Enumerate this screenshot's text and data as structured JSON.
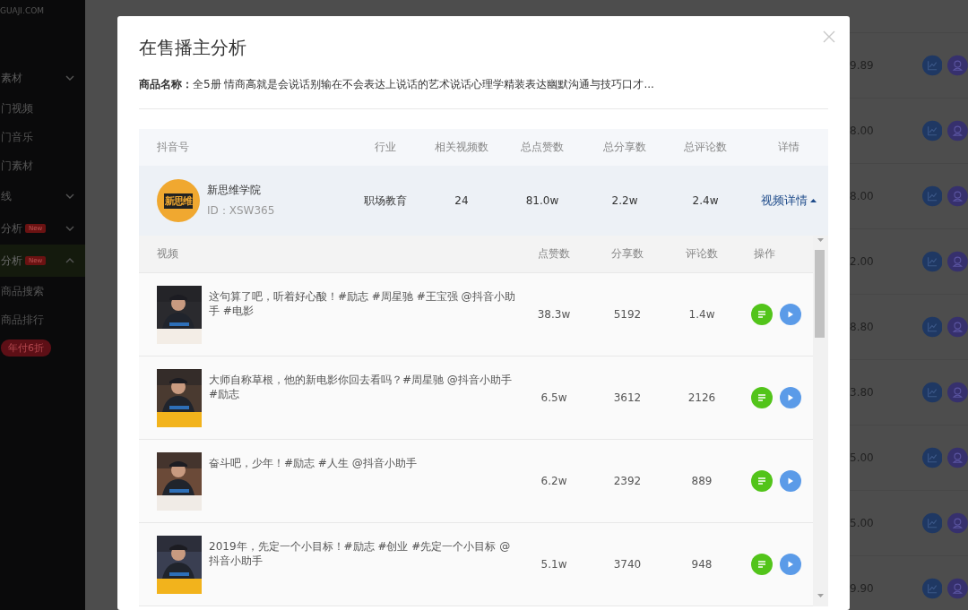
{
  "sidebar": {
    "brand": "GUAJI.COM",
    "items": [
      {
        "label": "素材",
        "kind": "group",
        "expanded": false,
        "selected": false
      },
      {
        "label": "门视频",
        "kind": "link",
        "selected": false
      },
      {
        "label": "门音乐",
        "kind": "link",
        "selected": false
      },
      {
        "label": "门素材",
        "kind": "link",
        "selected": false
      },
      {
        "label": "线",
        "kind": "group",
        "expanded": false,
        "selected": false
      },
      {
        "label": "分析",
        "kind": "group",
        "badge": "New",
        "expanded": false,
        "selected": false
      },
      {
        "label": "分析",
        "kind": "group",
        "badge": "New",
        "expanded": true,
        "selected": true
      },
      {
        "label": "商品搜索",
        "kind": "link",
        "selected": false
      },
      {
        "label": "商品排行",
        "kind": "link",
        "selected": false
      }
    ],
    "promo_badge": "年付6折"
  },
  "background_rows": [
    {
      "price": "9.89"
    },
    {
      "price": "8.00"
    },
    {
      "price": "8.00"
    },
    {
      "price": "2.00"
    },
    {
      "price": "8.80"
    },
    {
      "price": "3.80"
    },
    {
      "price": "5.00"
    },
    {
      "price": "5.00"
    },
    {
      "price": "9.90"
    }
  ],
  "modal": {
    "title": "在售播主分析",
    "product_label": "商品名称：",
    "product_name": "全5册 情商高就是会说话别输在不会表达上说话的艺术说话心理学精装表达幽默沟通与技巧口才...",
    "account_table": {
      "columns": [
        "抖音号",
        "行业",
        "相关视频数",
        "总点赞数",
        "总分享数",
        "总评论数",
        "详情"
      ],
      "rows": [
        {
          "logo_text": "新思维",
          "name": "新思维学院",
          "id": "ID：XSW365",
          "industry": "职场教育",
          "videos": "24",
          "likes": "81.0w",
          "shares": "2.2w",
          "comments": "2.4w",
          "detail": "视频详情",
          "expanded": true
        }
      ]
    },
    "video_table": {
      "columns": [
        "视频",
        "点赞数",
        "分享数",
        "评论数",
        "操作"
      ],
      "rows": [
        {
          "title": "这句算了吧，听着好心酸！#励志 #周星驰 #王宝强 @抖音小助手 #电影",
          "likes": "38.3w",
          "shares": "5192",
          "comments": "1.4w"
        },
        {
          "title": "大师自称草根，他的新电影你回去看吗？#周星驰 @抖音小助手 #励志",
          "likes": "6.5w",
          "shares": "3612",
          "comments": "2126"
        },
        {
          "title": "奋斗吧，少年！#励志 #人生 @抖音小助手",
          "likes": "6.2w",
          "shares": "2392",
          "comments": "889"
        },
        {
          "title": "2019年，先定一个小目标！#励志 #创业 #先定一个小目标 @抖音小助手",
          "likes": "5.1w",
          "shares": "3740",
          "comments": "948"
        }
      ]
    }
  }
}
